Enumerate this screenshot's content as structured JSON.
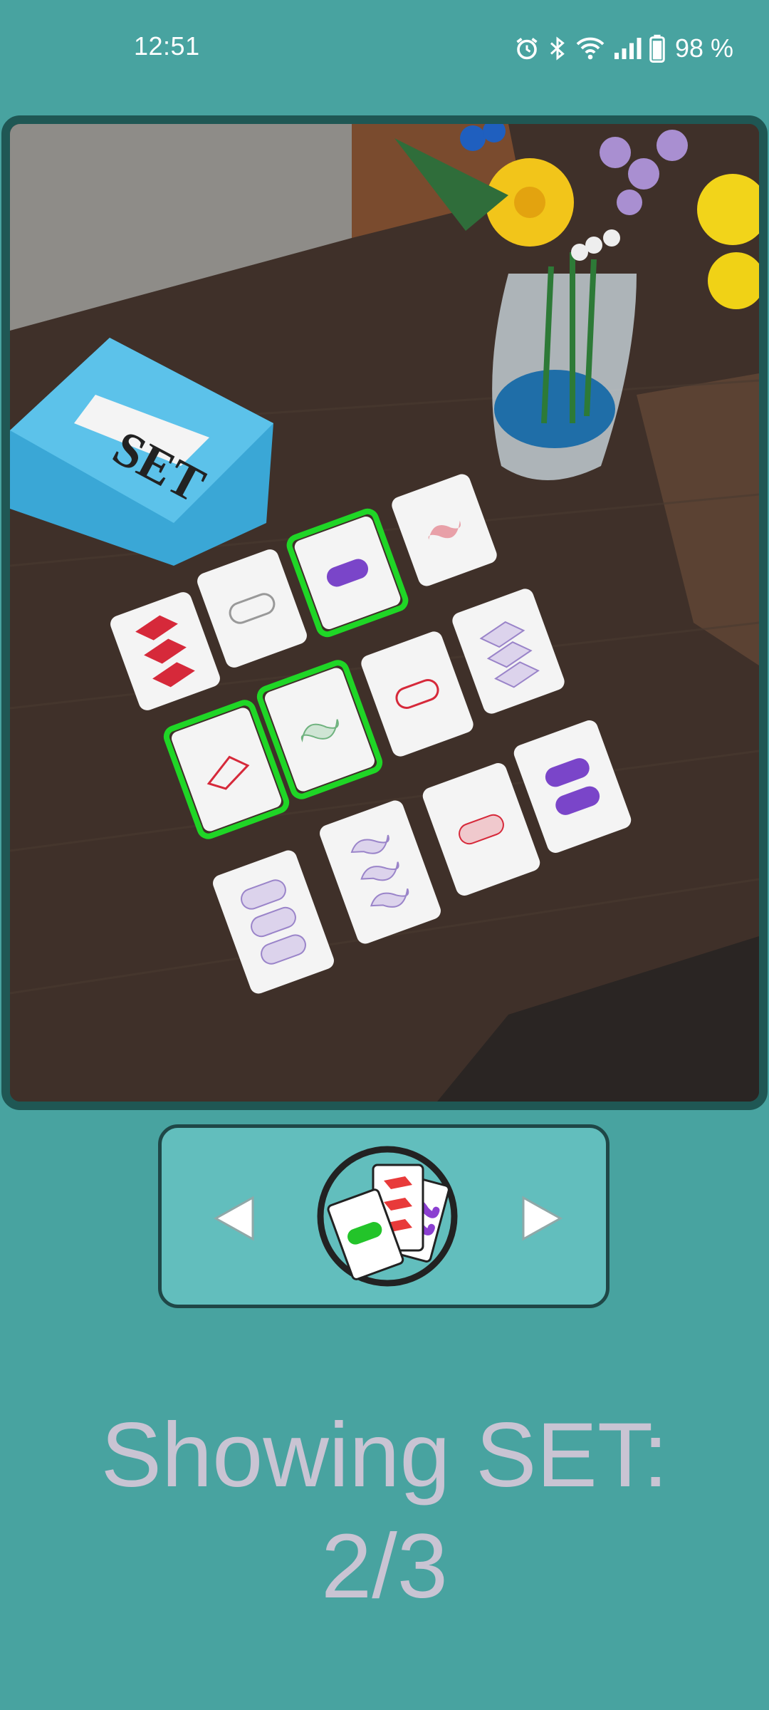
{
  "status_bar": {
    "time": "12:51",
    "icons": [
      "alarm-icon",
      "bluetooth-icon",
      "wifi-icon",
      "signal-icon",
      "battery-icon"
    ],
    "battery_percent": "98 %"
  },
  "photo": {
    "description_icon": "camera-photo",
    "set_box_text": "SET",
    "highlight_color": "#1fd626"
  },
  "navigation": {
    "prev_icon": "triangle-left-icon",
    "next_icon": "triangle-right-icon",
    "logo_icon": "set-cards-logo-icon"
  },
  "caption": {
    "line1": "Showing SET:",
    "line2": "2/3"
  },
  "colors": {
    "background": "#48a3a0",
    "panel": "#62bebd",
    "frame_border": "#1f5754",
    "caption_text": "#c9c4d3"
  }
}
